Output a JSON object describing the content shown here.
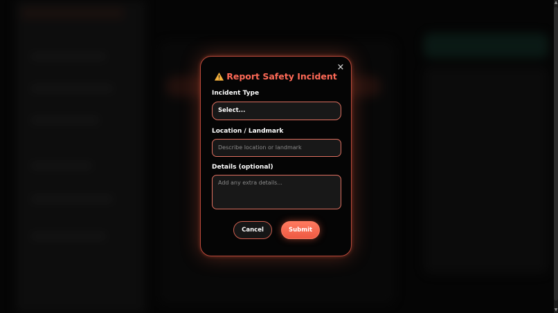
{
  "modal": {
    "title": "Report Safety Incident",
    "title_icon": "warning-triangle-icon",
    "close_label": "×",
    "incident_type": {
      "label": "Incident Type",
      "value": "Select..."
    },
    "location": {
      "label": "Location / Landmark",
      "placeholder": "Describe location or landmark"
    },
    "details": {
      "label": "Details (optional)",
      "placeholder": "Add any extra details..."
    },
    "buttons": {
      "cancel": "Cancel",
      "submit": "Submit"
    }
  },
  "colors": {
    "accent": "#ff6a57",
    "border": "#e07060",
    "background": "#050505",
    "field_bg": "#181818"
  },
  "scrollbar": {
    "up": "▲",
    "down": "▼"
  }
}
